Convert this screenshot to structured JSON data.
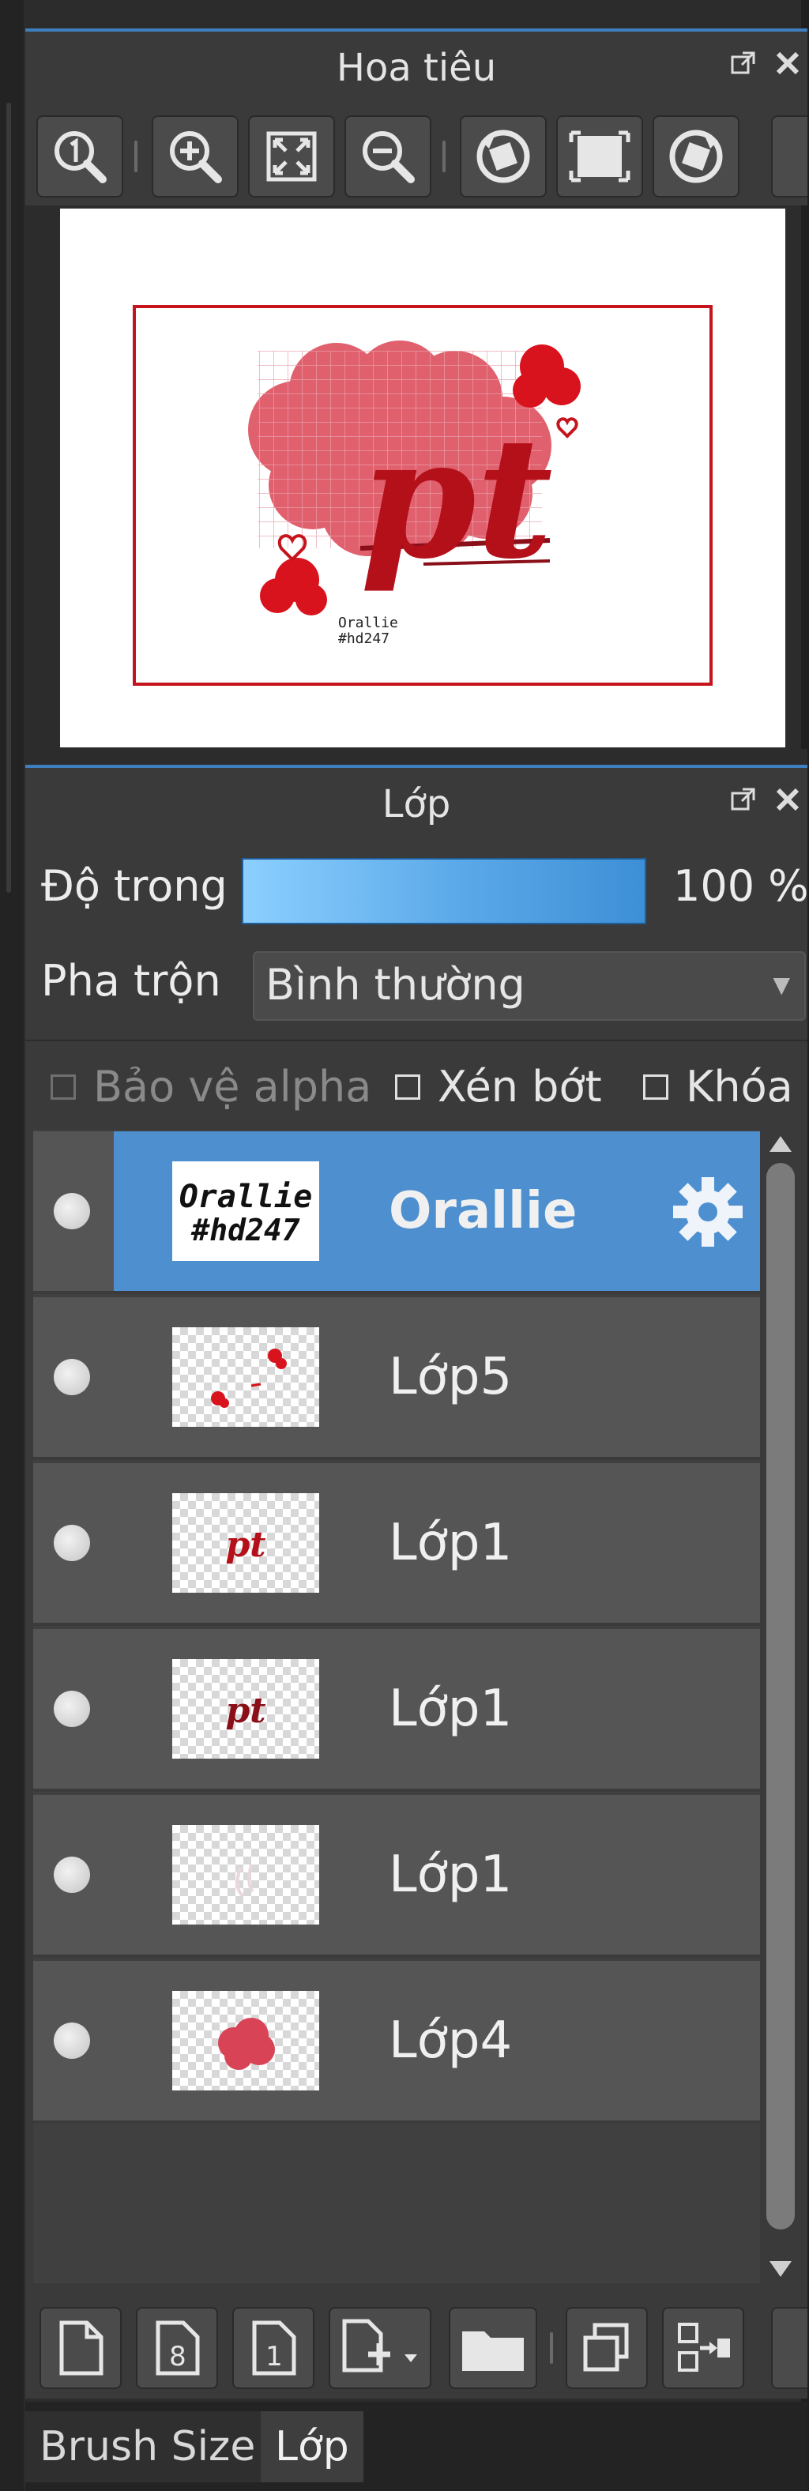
{
  "navigator": {
    "title": "Hoa tiêu",
    "window_buttons": [
      "float-icon",
      "close-icon"
    ],
    "toolbar": [
      "zoom-actual-icon",
      "zoom-in-icon",
      "fit-screen-icon",
      "zoom-out-icon",
      "rotate-left-icon",
      "flip-icon",
      "rotate-right-icon"
    ],
    "canvas_preview": {
      "artwork_text": "pt",
      "signature_line1": "Orallie",
      "signature_line2": "#hd247",
      "frame_color": "#c6141c"
    }
  },
  "layer_panel": {
    "title": "Lớp",
    "opacity_label": "Độ trong",
    "opacity_value": "100 %",
    "blend_label": "Pha trộn",
    "blend_value": "Bình thường",
    "checkboxes": [
      {
        "label": "Bảo vệ alpha",
        "checked": false,
        "enabled": false
      },
      {
        "label": "Xén bớt",
        "checked": false,
        "enabled": true
      },
      {
        "label": "Khóa",
        "checked": false,
        "enabled": true
      }
    ],
    "layers": [
      {
        "name": "Orallie",
        "selected": true,
        "thumb_text_1": "Orallie",
        "thumb_text_2": "#hd247"
      },
      {
        "name": "Lớp5",
        "selected": false
      },
      {
        "name": "Lớp1",
        "selected": false,
        "thumb_text": "pt"
      },
      {
        "name": "Lớp1",
        "selected": false,
        "thumb_text": "pt"
      },
      {
        "name": "Lớp1",
        "selected": false
      },
      {
        "name": "Lớp4",
        "selected": false
      }
    ],
    "bottom_toolbar": [
      "new-layer-icon",
      "new-layer-8bit-icon",
      "new-layer-1bit-icon",
      "add-layer-menu-icon",
      "new-folder-icon",
      "duplicate-layer-icon",
      "merge-down-icon"
    ],
    "bottom_toolbar_labels": {
      "eight": "8",
      "one": "1"
    }
  },
  "tabs": [
    {
      "label": "Brush Size",
      "active": false
    },
    {
      "label": "Lớp",
      "active": true
    }
  ],
  "colors": {
    "accent": "#4d8fcf",
    "panel": "#3a3a3a",
    "row": "#555555",
    "artwork_red": "#c6141c",
    "artwork_pink": "#e0606e"
  }
}
